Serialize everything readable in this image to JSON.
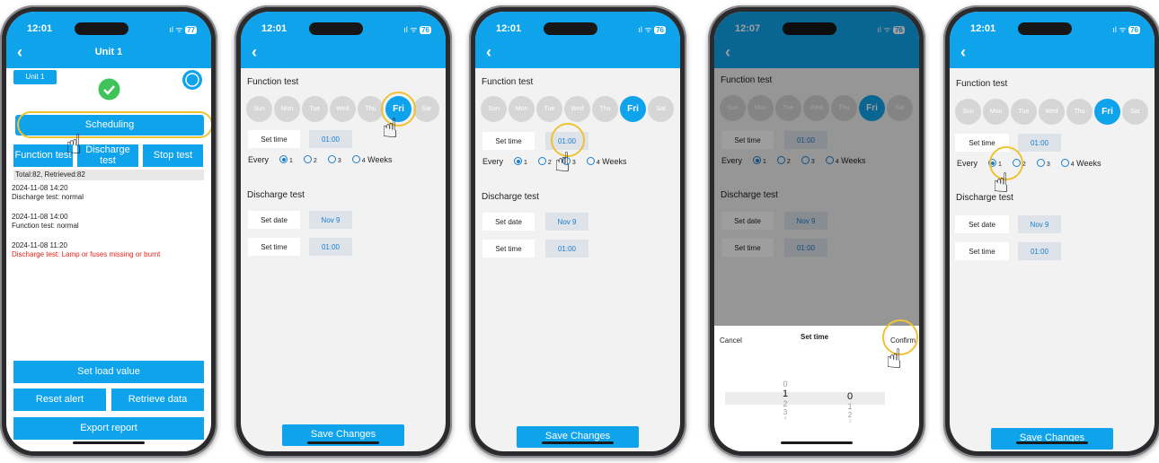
{
  "status": {
    "s1_time": "12:01",
    "s1_batt": "77",
    "s2_time": "12:01",
    "s2_batt": "76",
    "s3_time": "12:01",
    "s3_batt": "76",
    "s4_time": "12:07",
    "s4_batt": "76",
    "s5_time": "12:01",
    "s5_batt": "76"
  },
  "nav": {
    "back": "‹",
    "s1_title": "Unit 1"
  },
  "unit": {
    "badge": "Unit 1",
    "scheduling": "Scheduling",
    "function_test": "Function test",
    "discharge_test": "Discharge test",
    "stop_test": "Stop test",
    "totals": "Total:82, Retrieved:82",
    "records": [
      {
        "date": "2024-11-08 14:20",
        "text": "Discharge test: normal",
        "alert": false
      },
      {
        "date": "2024-11-08 14:00",
        "text": "Function test: normal",
        "alert": false
      },
      {
        "date": "2024-11-08 11:20",
        "text": "Discharge test: Lamp or fuses missing or burnt",
        "alert": true
      }
    ],
    "set_load": "Set load value",
    "reset_alert": "Reset alert",
    "retrieve_data": "Retrieve data",
    "export_report": "Export report"
  },
  "schedule": {
    "function_title": "Function test",
    "days": [
      "Sun",
      "Mon",
      "Tue",
      "Wed",
      "Thu",
      "Fri",
      "Sat"
    ],
    "selected_day": "Fri",
    "set_time": "Set time",
    "time_value": "01:00",
    "every": "Every",
    "options": [
      "1",
      "2",
      "3",
      "4"
    ],
    "weeks": "Weeks",
    "discharge_title": "Discharge test",
    "set_date": "Set date",
    "date_value": "Nov 9",
    "save": "Save Changes"
  },
  "picker": {
    "cancel": "Cancel",
    "title": "Set time",
    "confirm": "Confirm",
    "hours": [
      "0",
      "1",
      "2",
      "3",
      "4"
    ],
    "minutes": [
      "0",
      "1",
      "2",
      "3"
    ]
  },
  "colors": {
    "accent": "#0fa3ec",
    "highlight": "#efc234",
    "alert": "#e6231b"
  }
}
